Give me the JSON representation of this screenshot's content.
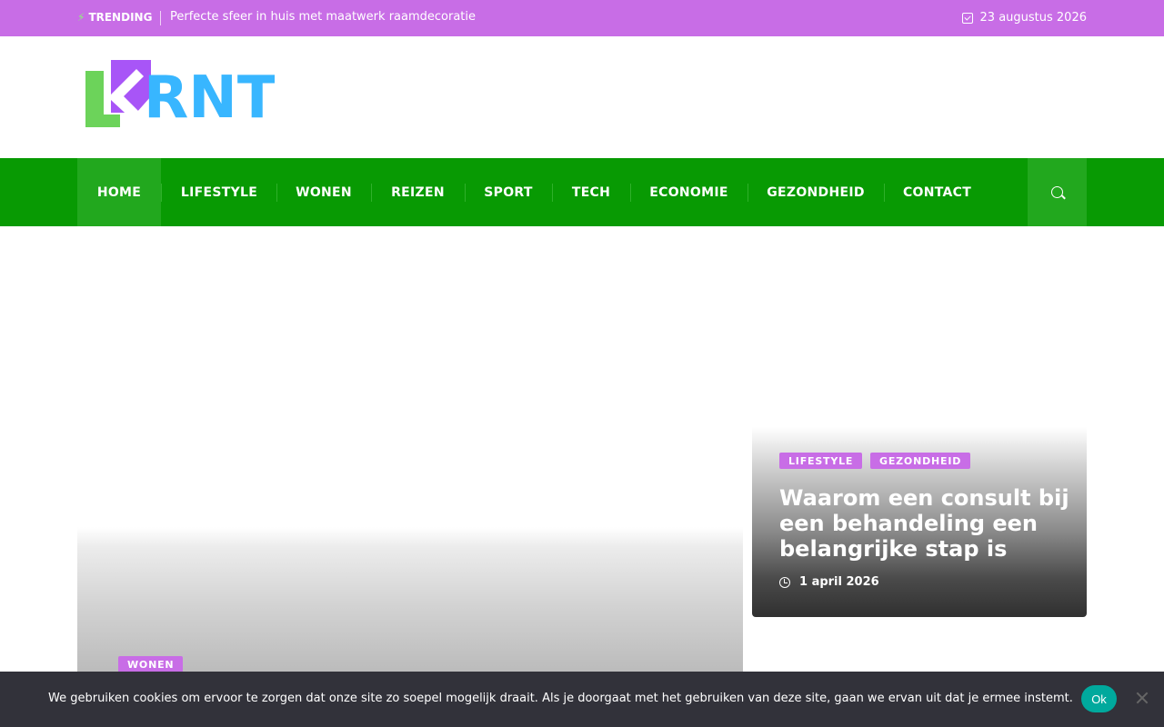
{
  "topbar": {
    "trending_label": "TRENDING",
    "trending_icon": "bolt-icon",
    "headline": "Perfecte sfeer in huis met maatwerk raamdecoratie",
    "date": "23 augustus 2026",
    "date_icon": "calendar-check-icon"
  },
  "logo": {
    "text": "RNT",
    "colors": {
      "k_green": "#6cd35a",
      "k_purple": "#a855f7",
      "letters_blue": "#38b6ff"
    }
  },
  "nav": {
    "items": [
      {
        "label": "HOME",
        "active": true
      },
      {
        "label": "LIFESTYLE"
      },
      {
        "label": "WONEN"
      },
      {
        "label": "REIZEN"
      },
      {
        "label": "SPORT"
      },
      {
        "label": "TECH"
      },
      {
        "label": "ECONOMIE"
      },
      {
        "label": "GEZONDHEID"
      },
      {
        "label": "CONTACT"
      }
    ],
    "search_icon": "search-icon"
  },
  "feature_left": {
    "category": "WONEN"
  },
  "feature_right": {
    "categories": [
      "LIFESTYLE",
      "GEZONDHEID"
    ],
    "title": "Waarom een consult bij een behandeling een belangrijke stap is",
    "date": "1 april 2026",
    "date_icon": "clock-icon"
  },
  "cookie": {
    "text": "We gebruiken cookies om ervoor te zorgen dat onze site zo soepel mogelijk draait. Als je doorgaat met het gebruiken van deze site, gaan we ervan uit dat je ermee instemt.",
    "ok_label": "Ok"
  },
  "colors": {
    "topbar": "#c86de6",
    "nav": "#089a03",
    "nav_active": "#22a81e",
    "badge": "#c86de6",
    "cookie_bg": "#32323a",
    "ok_button": "#00a99d"
  }
}
